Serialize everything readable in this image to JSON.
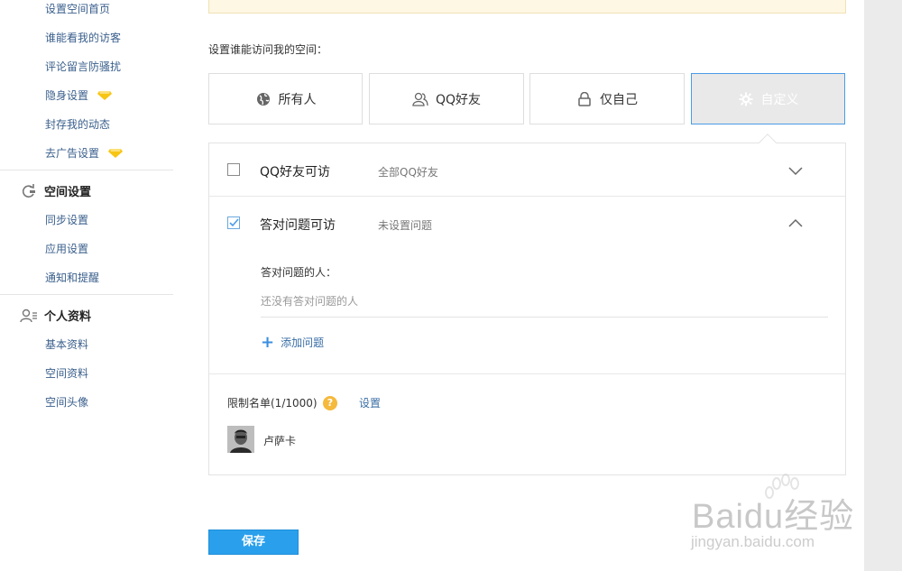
{
  "sidebar": {
    "group1_items": [
      {
        "label": "设置空间首页"
      },
      {
        "label": "谁能看我的访客"
      },
      {
        "label": "评论留言防骚扰"
      },
      {
        "label": "隐身设置",
        "badge": "diamond"
      },
      {
        "label": "封存我的动态"
      },
      {
        "label": "去广告设置",
        "badge": "diamond"
      }
    ],
    "space_settings": {
      "title": "空间设置",
      "icon": "refresh-icon",
      "items": [
        {
          "label": "同步设置"
        },
        {
          "label": "应用设置"
        },
        {
          "label": "通知和提醒"
        }
      ]
    },
    "profile": {
      "title": "个人资料",
      "icon": "person-icon",
      "items": [
        {
          "label": "基本资料"
        },
        {
          "label": "空间资料"
        },
        {
          "label": "空间头像"
        }
      ]
    }
  },
  "main": {
    "section_label": "设置谁能访问我的空间：",
    "visibility_options": [
      {
        "label": "所有人",
        "icon": "globe-icon",
        "active": false
      },
      {
        "label": "QQ好友",
        "icon": "friends-icon",
        "active": false
      },
      {
        "label": "仅自己",
        "icon": "lock-icon",
        "active": false
      },
      {
        "label": "自定义",
        "icon": "gear-icon",
        "active": true
      }
    ],
    "custom_panel": {
      "qq_friends": {
        "title": "QQ好友可访",
        "desc": "全部QQ好友",
        "checked": false,
        "expanded": false
      },
      "answer_question": {
        "title": "答对问题可访",
        "desc": "未设置问题",
        "checked": true,
        "expanded": true,
        "people_label": "答对问题的人：",
        "people_empty": "还没有答对问题的人",
        "add_question": "添加问题"
      },
      "restriction": {
        "label": "限制名单(1/1000)",
        "help": "?",
        "settings_link": "设置",
        "users": [
          {
            "name": "卢萨卡"
          }
        ]
      }
    },
    "save_label": "保存"
  },
  "watermark": {
    "brand": "Baidu经验",
    "url": "jingyan.baidu.com"
  },
  "colors": {
    "accent": "#2aa0ec",
    "link": "#3a6ea5",
    "badge": "#f5b93c",
    "diamond": "#f7c514"
  }
}
